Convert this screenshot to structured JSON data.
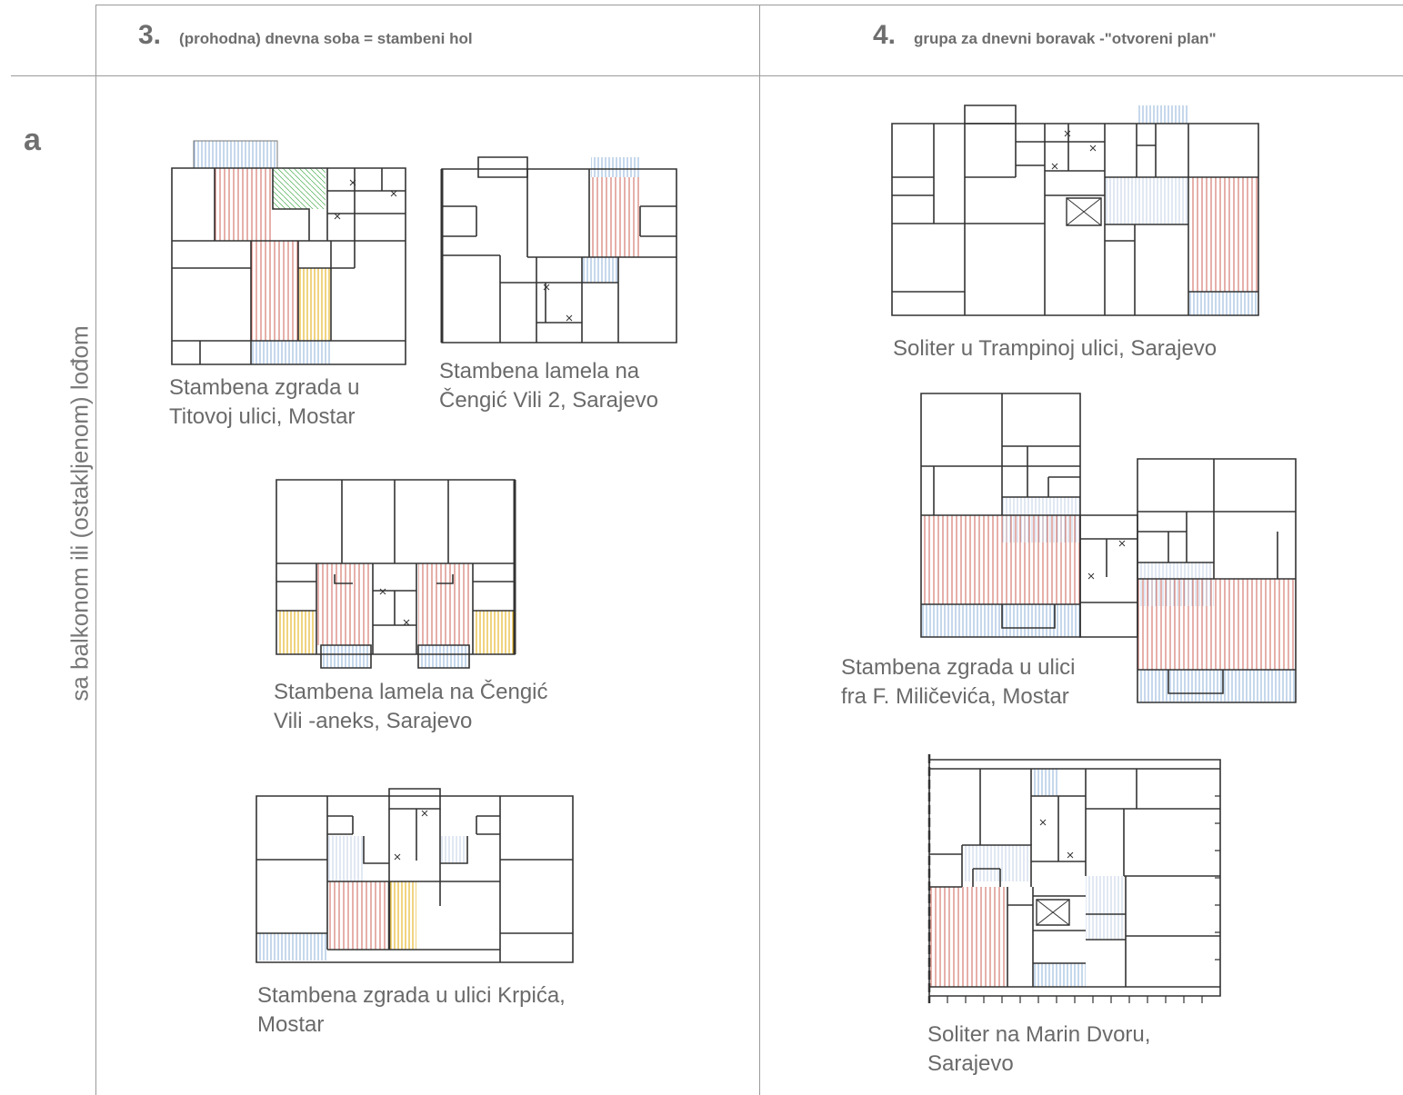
{
  "columns": [
    {
      "number": "3.",
      "title": "(prohodna) dnevna soba = stambeni hol"
    },
    {
      "number": "4.",
      "title": "grupa za dnevni boravak -\"otvoreni plan\""
    }
  ],
  "row": {
    "letter": "a",
    "label": "sa balkonom ili (ostakljenom) lođom"
  },
  "captions": {
    "mostar_titova": [
      "Stambena zgrada u",
      "Titovoj ulici, Mostar"
    ],
    "cengic_vili_2": [
      "Stambena lamela na",
      "Čengić Vili 2, Sarajevo"
    ],
    "cengic_vili_aneks": [
      "Stambena lamela na Čengić",
      "Vili -aneks, Sarajevo"
    ],
    "mostar_krpica": [
      "Stambena zgrada u ulici Krpića,",
      "Mostar"
    ],
    "trampina": [
      "Soliter u Trampinoj ulici, Sarajevo"
    ],
    "milicevica": [
      "Stambena zgrada u ulici",
      "fra F. Miličevića, Mostar"
    ],
    "marin_dvor": [
      "Soliter na Marin Dvoru,",
      "Sarajevo"
    ]
  },
  "colors": {
    "living_hatch": "#c0392b",
    "balcony_hatch": "#5b8fc9",
    "loggia_hatch": "#e0a800",
    "kitchen_hatch": "#4caf50",
    "wall": "#333333",
    "grid": "#9a9a9a"
  }
}
